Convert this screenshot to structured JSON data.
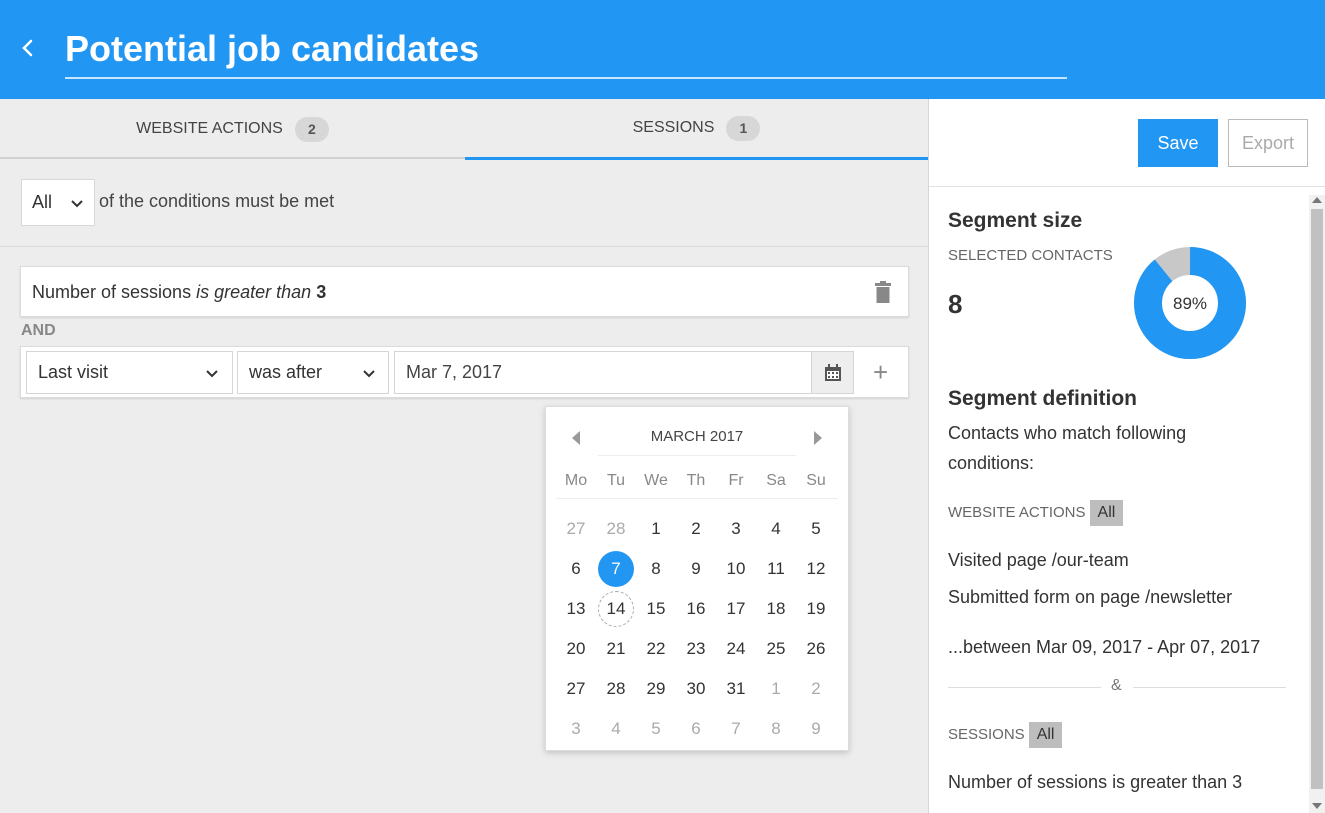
{
  "header": {
    "title": "Potential job candidates"
  },
  "tabs": [
    {
      "label": "WEBSITE ACTIONS",
      "count": "2"
    },
    {
      "label": "SESSIONS",
      "count": "1"
    }
  ],
  "conditions": {
    "match_value": "All",
    "text": "of the conditions must be met"
  },
  "rule1": {
    "prefix": "Number of sessions",
    "operator": "is greater than",
    "value": "3"
  },
  "and_label": "AND",
  "rule2": {
    "field": "Last visit",
    "operator": "was after",
    "date": "Mar 7, 2017"
  },
  "datepicker": {
    "month": "MARCH 2017",
    "weekdays": [
      "Mo",
      "Tu",
      "We",
      "Th",
      "Fr",
      "Sa",
      "Su"
    ],
    "weeks": [
      [
        "27",
        "28",
        "1",
        "2",
        "3",
        "4",
        "5"
      ],
      [
        "6",
        "7",
        "8",
        "9",
        "10",
        "11",
        "12"
      ],
      [
        "13",
        "14",
        "15",
        "16",
        "17",
        "18",
        "19"
      ],
      [
        "20",
        "21",
        "22",
        "23",
        "24",
        "25",
        "26"
      ],
      [
        "27",
        "28",
        "29",
        "30",
        "31",
        "1",
        "2"
      ],
      [
        "3",
        "4",
        "5",
        "6",
        "7",
        "8",
        "9"
      ]
    ],
    "selected": "7",
    "today": "14"
  },
  "right": {
    "save_label": "Save",
    "export_label": "Export",
    "segment_size_title": "Segment size",
    "selected_contacts_label": "SELECTED CONTACTS",
    "selected_contacts_value": "8",
    "percent_label": "89%",
    "percent_value": 89,
    "segment_def_title": "Segment definition",
    "segment_def_desc": "Contacts who match following conditions:",
    "website_actions_label": "WEBSITE ACTIONS",
    "website_actions_pill": "All",
    "action1": "Visited page /our-team",
    "action2": "Submitted form on page /newsletter",
    "date_range": "...between Mar 09, 2017 - Apr 07, 2017",
    "amp": "&",
    "sessions_label": "SESSIONS",
    "sessions_pill": "All",
    "session_rule": "Number of sessions is greater than 3"
  },
  "colors": {
    "accent": "#2196f3",
    "donut_rest": "#c8c8c8"
  }
}
